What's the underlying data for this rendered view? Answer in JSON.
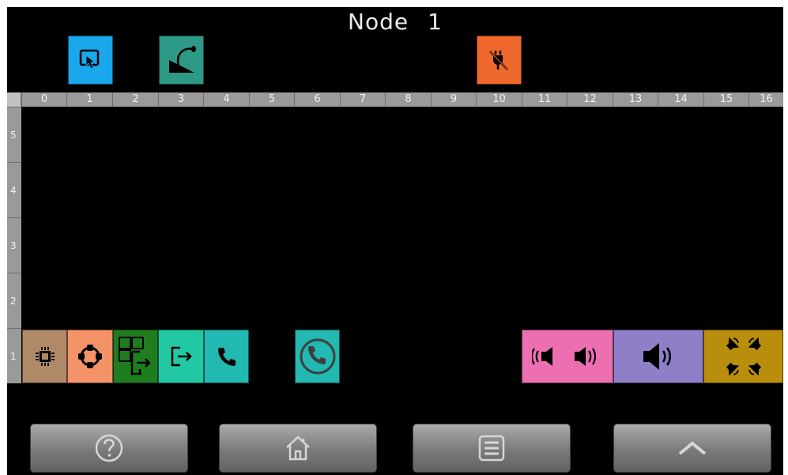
{
  "header": {
    "title": "Node",
    "node_number": "1"
  },
  "ruler": {
    "columns": [
      "0",
      "1",
      "2",
      "3",
      "4",
      "5",
      "6",
      "7",
      "8",
      "9",
      "10",
      "11",
      "12",
      "13",
      "14",
      "15",
      "16"
    ],
    "rows": [
      "5",
      "4",
      "3",
      "2",
      "1"
    ]
  },
  "top_icons": [
    {
      "name": "touch-screen-icon",
      "color": "#1aa7ec"
    },
    {
      "name": "gooseneck-mic-icon",
      "color": "#2d9a86"
    },
    {
      "name": "no-power-plug-icon",
      "color": "#f0692c"
    }
  ],
  "slots": [
    {
      "name": "chip-module-tile",
      "color": "#b08a68"
    },
    {
      "name": "network-ring-tile",
      "color": "#f49368"
    },
    {
      "name": "multi-output-tile",
      "color": "#1f7d1f"
    },
    {
      "name": "output-tile",
      "color": "#22c7a3"
    },
    {
      "name": "phone-tile",
      "color": "#21b9b1"
    },
    {
      "name": "phone-circle-tile",
      "color": "#21b9b1"
    },
    {
      "name": "stereo-speakers-tile",
      "color": "#ec6fb1"
    },
    {
      "name": "speaker-tile",
      "color": "#8e7fc8"
    },
    {
      "name": "four-speakers-tile",
      "color": "#b98e0c"
    }
  ],
  "buttons": {
    "help": "question-circle-icon",
    "home": "home-icon",
    "menu": "menu-icon",
    "up": "chevron-up-icon"
  }
}
